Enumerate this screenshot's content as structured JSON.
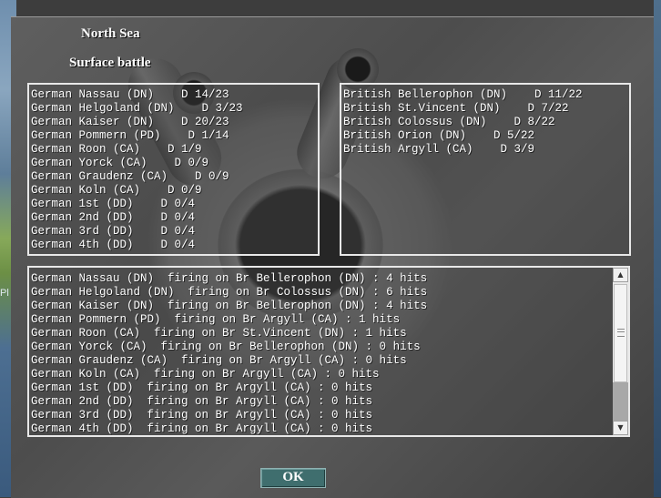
{
  "dialog": {
    "region": "North Sea",
    "battle_type": "Surface battle",
    "edge_fragment": "Pl"
  },
  "german_fleet": [
    "German Nassau (DN)    D 14/23",
    "German Helgoland (DN)    D 3/23",
    "German Kaiser (DN)    D 20/23",
    "German Pommern (PD)    D 1/14",
    "German Roon (CA)    D 1/9",
    "German Yorck (CA)    D 0/9",
    "German Graudenz (CA)    D 0/9",
    "German Koln (CA)    D 0/9",
    "German 1st (DD)    D 0/4",
    "German 2nd (DD)    D 0/4",
    "German 3rd (DD)    D 0/4",
    "German 4th (DD)    D 0/4"
  ],
  "british_fleet": [
    "British Bellerophon (DN)    D 11/22",
    "British St.Vincent (DN)    D 7/22",
    "British Colossus (DN)    D 8/22",
    "British Orion (DN)    D 5/22",
    "British Argyll (CA)    D 3/9"
  ],
  "combat_log": [
    "German Nassau (DN)  firing on Br Bellerophon (DN) : 4 hits",
    "German Helgoland (DN)  firing on Br Colossus (DN) : 6 hits",
    "German Kaiser (DN)  firing on Br Bellerophon (DN) : 4 hits",
    "German Pommern (PD)  firing on Br Argyll (CA) : 1 hits",
    "German Roon (CA)  firing on Br St.Vincent (DN) : 1 hits",
    "German Yorck (CA)  firing on Br Bellerophon (DN) : 0 hits",
    "German Graudenz (CA)  firing on Br Argyll (CA) : 0 hits",
    "German Koln (CA)  firing on Br Argyll (CA) : 0 hits",
    "German 1st (DD)  firing on Br Argyll (CA) : 0 hits",
    "German 2nd (DD)  firing on Br Argyll (CA) : 0 hits",
    "German 3rd (DD)  firing on Br Argyll (CA) : 0 hits",
    "German 4th (DD)  firing on Br Argyll (CA) : 0 hits"
  ],
  "scrollbar": {
    "up_icon": "triangle-up-icon",
    "down_icon": "triangle-down-icon"
  },
  "buttons": {
    "ok_label": "OK",
    "ok_color": "#3f6e6e"
  }
}
